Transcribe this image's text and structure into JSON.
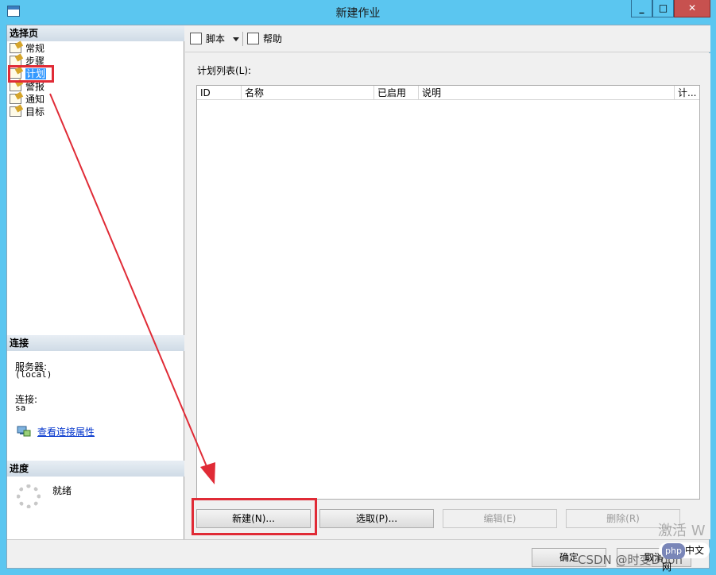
{
  "window": {
    "title": "新建作业"
  },
  "left_panel": {
    "select_page_header": "选择页",
    "pages": [
      {
        "label": "常规"
      },
      {
        "label": "步骤"
      },
      {
        "label": "计划"
      },
      {
        "label": "警报"
      },
      {
        "label": "通知"
      },
      {
        "label": "目标"
      }
    ],
    "selected_page": "计划",
    "connection_header": "连接",
    "server_label": "服务器:",
    "server_value": "(local)",
    "connection_label": "连接:",
    "connection_value": "sa",
    "view_connection_link": "查看连接属性",
    "progress_header": "进度",
    "progress_status": "就绪"
  },
  "toolbar": {
    "script_label": "脚本",
    "help_label": "帮助"
  },
  "main": {
    "list_label": "计划列表(L):",
    "columns": [
      "ID",
      "名称",
      "已启用",
      "说明",
      "计..."
    ],
    "rows": []
  },
  "buttons": {
    "new": "新建(N)...",
    "pick": "选取(P)...",
    "edit": "编辑(E)",
    "delete": "删除(R)"
  },
  "footer": {
    "ok": "确定",
    "cancel": "取消"
  },
  "overlay": {
    "watermark": "激活 W",
    "csdn": "CSDN @时变Dooh",
    "php_badge": "php",
    "php_badge_suffix": "中文网"
  },
  "colors": {
    "titlebar": "#5bc6f0",
    "selection": "#3399ff",
    "annotation_red": "#e02b36",
    "close_button": "#c7514f"
  },
  "icons": {
    "app": "app-window-icon",
    "page": "page-properties-icon",
    "script": "script-icon",
    "help": "help-icon",
    "connection": "connection-properties-icon",
    "spinner": "progress-spinner-icon"
  }
}
